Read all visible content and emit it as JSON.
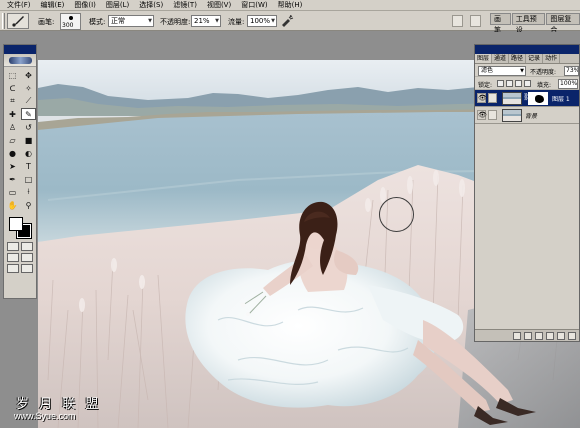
{
  "menu": [
    "文件(F)",
    "编辑(E)",
    "图像(I)",
    "图层(L)",
    "选择(S)",
    "滤镜(T)",
    "视图(V)",
    "窗口(W)",
    "帮助(H)"
  ],
  "options": {
    "brush_label": "画笔:",
    "brush_size": "300",
    "mode_label": "模式:",
    "mode_value": "正常",
    "opacity_label": "不透明度:",
    "opacity_value": "21%",
    "flow_label": "流量:",
    "flow_value": "100%"
  },
  "well_tabs": [
    "画笔",
    "工具预设",
    "图层复合"
  ],
  "layers_panel": {
    "tabs": [
      "图层",
      "通道",
      "路径",
      "记录",
      "动作"
    ],
    "blend_mode": "滤色",
    "opacity_label": "不透明度:",
    "opacity_value": "73%",
    "lock_label": "锁定:",
    "fill_label": "填充:",
    "fill_value": "100%",
    "layers": [
      {
        "name": "图层 1",
        "selected": true
      },
      {
        "name": "背景",
        "selected": false
      }
    ]
  },
  "watermark": {
    "title": "岁 月 联 盟",
    "url": "www.Syue.com"
  },
  "colors": {
    "title_bar": "#0a246a",
    "chrome": "#d4d0c8",
    "workspace": "#8e8e8e"
  }
}
